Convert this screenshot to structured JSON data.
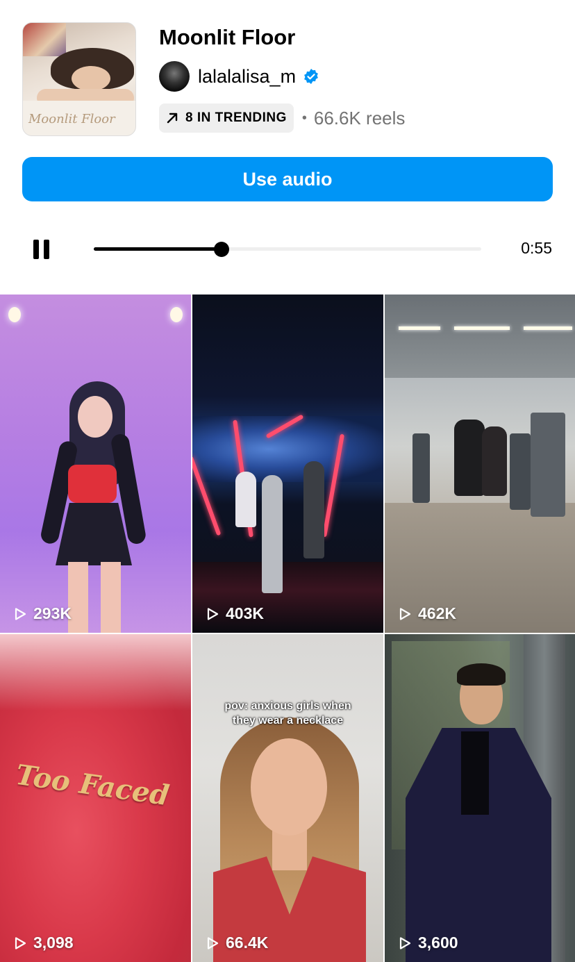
{
  "audio": {
    "title": "Moonlit Floor",
    "artist": "lalalalisa_m",
    "verified": true,
    "trending_label": "8 IN TRENDING",
    "separator": "•",
    "reels_count": "66.6K reels",
    "cover_text": "Moonlit Floor"
  },
  "actions": {
    "use_audio_label": "Use audio"
  },
  "player": {
    "state_icon": "pause-icon",
    "progress": 0.33,
    "duration": "0:55"
  },
  "reels": [
    {
      "views": "293K"
    },
    {
      "views": "403K"
    },
    {
      "views": "462K"
    },
    {
      "views": "3,098",
      "brand_text": "Too Faced"
    },
    {
      "views": "66.4K",
      "caption": "pov: anxious girls when they wear a necklace"
    },
    {
      "views": "3,600"
    }
  ],
  "colors": {
    "accent": "#0095f6",
    "verified_badge": "#0095f6",
    "secondary_text": "#737373"
  }
}
